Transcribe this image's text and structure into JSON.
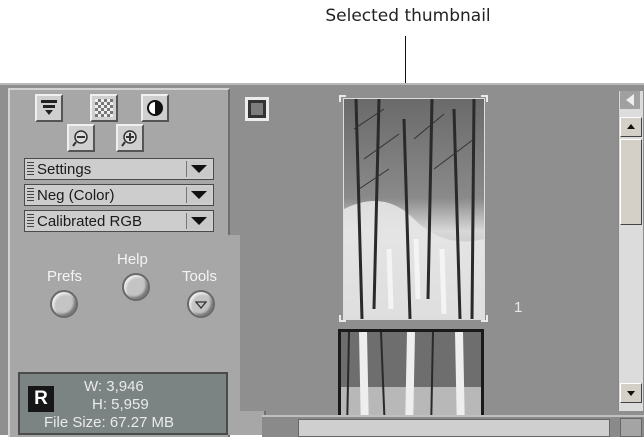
{
  "callout": {
    "text": "Selected thumbnail"
  },
  "toolbar": {
    "tools": [
      {
        "name": "unload-film-icon"
      },
      {
        "name": "grain-filter-icon"
      },
      {
        "name": "color-balance-icon"
      },
      {
        "name": "zoom-out-icon"
      },
      {
        "name": "zoom-in-icon"
      }
    ]
  },
  "dropdowns": {
    "settings": "Settings",
    "film_type": "Neg (Color)",
    "color_space": "Calibrated RGB"
  },
  "buttons": {
    "prefs": "Prefs",
    "help": "Help",
    "tools": "Tools"
  },
  "info": {
    "channel": "R",
    "width": "W: 3,946",
    "height": "H: 5,959",
    "file_size": "File Size: 67.27 MB"
  },
  "filmstrip": {
    "selected_frame_number": "1"
  },
  "colors": {
    "panel": "#a7a7a7",
    "background": "#8f8f8f",
    "info_box": "#7b8383"
  }
}
